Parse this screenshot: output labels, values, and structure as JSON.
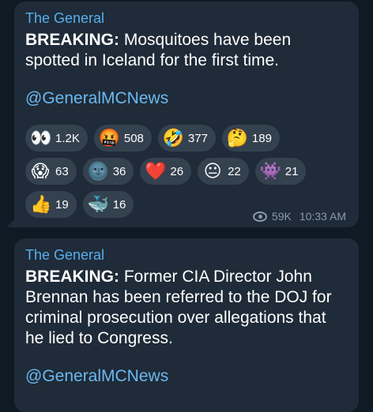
{
  "messages": [
    {
      "sender": "The General",
      "text_bold": "BREAKING:",
      "text": " Mosquitoes have been spotted in Iceland for the first time.",
      "link": "@GeneralMCNews",
      "reactions": [
        [
          {
            "emoji": "👀",
            "icon": "eyes-icon",
            "count": "1.2K"
          },
          {
            "emoji": "🤬",
            "icon": "cursing-face-icon",
            "count": "508"
          },
          {
            "emoji": "🤣",
            "icon": "rofl-icon",
            "count": "377"
          },
          {
            "emoji": "🤔",
            "icon": "thinking-face-icon",
            "count": "189"
          }
        ],
        [
          {
            "emoji": "😱",
            "icon": "screaming-face-icon",
            "count": "63"
          },
          {
            "emoji": "🌚",
            "icon": "new-moon-face-icon",
            "count": "36"
          },
          {
            "emoji": "❤️",
            "icon": "heart-icon",
            "count": "26"
          },
          {
            "emoji": "😐",
            "icon": "neutral-face-icon",
            "count": "22"
          },
          {
            "emoji": "👾",
            "icon": "alien-monster-icon",
            "count": "21"
          }
        ],
        [
          {
            "emoji": "👍",
            "icon": "thumbs-up-icon",
            "count": "19"
          },
          {
            "emoji": "🐳",
            "icon": "whale-icon",
            "count": "16"
          }
        ]
      ],
      "views": "59K",
      "time": "10:33 AM"
    },
    {
      "sender": "The General",
      "text_bold": "BREAKING:",
      "text": " Former CIA Director John Brennan has been referred to the DOJ for criminal prosecution over allegations that he lied to Congress.",
      "link": "@GeneralMCNews"
    }
  ]
}
